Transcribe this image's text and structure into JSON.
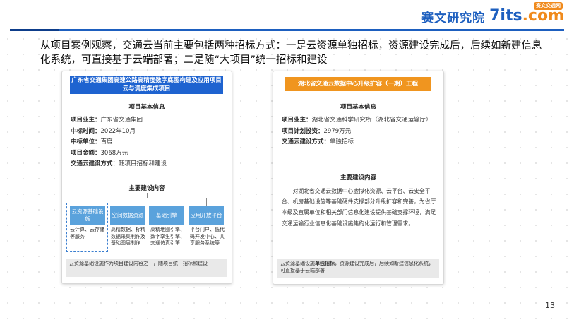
{
  "logo": {
    "cn": "赛文研究院",
    "en": "7its",
    "en_suffix": ".com",
    "badge": "赛文交通网"
  },
  "heading": "从项目案例观察，交通云当前主要包括两种招标方式：一是云资源单独招标，资源建设完成后，后续如新建信息化系统，可直接基于云端部署；二是随“大项目”统一招标和建设",
  "left_card": {
    "title": "广东省交通集团高速公路高精度数字底图构建及应用项目云与调度集成项目",
    "basic_title": "项目基本信息",
    "info": [
      {
        "label": "项目业主：",
        "value": "广东省交通集团"
      },
      {
        "label": "中标时间：",
        "value": "2022年10月"
      },
      {
        "label": "中标单位：",
        "value": "百度"
      },
      {
        "label": "项目金额：",
        "value": "3068万元"
      },
      {
        "label": "交通云建设方式：",
        "value": "随项目招标和建设"
      }
    ],
    "content_title": "主要建设内容",
    "categories": [
      {
        "title": "云资源基础设施",
        "desc": "云计算、云存储等服务"
      },
      {
        "title": "空间数据资源",
        "desc": "高精数据、标精数据采集制作及基础图层制作"
      },
      {
        "title": "基础引擎",
        "desc": "高精地图引擎、数字孪生引擎、交通仿真引擎"
      },
      {
        "title": "应用开放平台",
        "desc": "平台门户、低代码开发中心、共享服务系统等"
      }
    ],
    "note": "云资源基础设施作为项目建设内容之一，随项目统一招标和建设"
  },
  "right_card": {
    "title": "湖北省交通云数据中心升级扩容（一期）工程",
    "basic_title": "项目基本信息",
    "info": [
      {
        "label": "项目业主：",
        "value": "湖北省交通科学研究所（湖北省交通运输厅）"
      },
      {
        "label": "项目计划投资：",
        "value": "2979万元"
      },
      {
        "label": "交通云建设方式：",
        "value": "单独招标"
      }
    ],
    "content_title": "主要建设内容",
    "paragraph": "对湖北省交通云数据中心虚拟化资源、云平台、云安全平台、机房基础设施等基础硬件支撑部分升级扩容和完善，为省厅本级及直属单位和相关部门信息化建设提供基础支撑环境，满足交通运输行业信息化基础设施集约化运行和管理需求。",
    "note_prefix": "云资源基础设施",
    "note_bold": "单独招标",
    "note_rest": "，资源建设完成后，后续如新建信息化系统，可直接基于云端部署"
  },
  "page_number": "13"
}
